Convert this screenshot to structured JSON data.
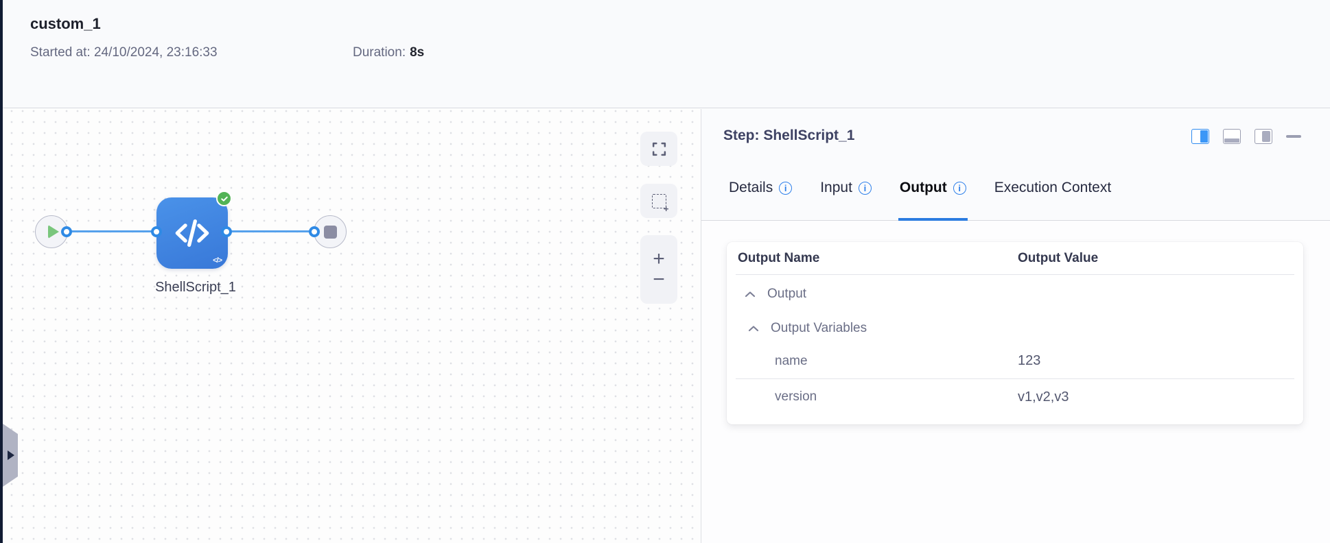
{
  "header": {
    "title": "custom_1",
    "started_label": "Started at:",
    "started_value": "24/10/2024, 23:16:33",
    "duration_label": "Duration:",
    "duration_value": "8s"
  },
  "canvas": {
    "node_label": "ShellScript_1"
  },
  "icons": {
    "info_glyph": "i",
    "zoom_in_glyph": "+",
    "zoom_out_glyph": "−",
    "marquee_plus_glyph": "+",
    "code_watermark": "</>"
  },
  "panel": {
    "title": "Step: ShellScript_1",
    "tabs": [
      {
        "label": "Details"
      },
      {
        "label": "Input"
      },
      {
        "label": "Output"
      },
      {
        "label": "Execution Context"
      }
    ],
    "table": {
      "columns": [
        "Output Name",
        "Output Value"
      ],
      "rows": [
        {
          "label": "Output",
          "value": ""
        },
        {
          "label": "Output Variables",
          "value": ""
        },
        {
          "label": "name",
          "value": "123"
        },
        {
          "label": "version",
          "value": "v1,v2,v3"
        }
      ]
    }
  },
  "colors": {
    "accent_blue": "#2b7ce0",
    "node_blue": "#3d85e2",
    "edge_blue": "#55a1ec",
    "success_green": "#52b356"
  }
}
